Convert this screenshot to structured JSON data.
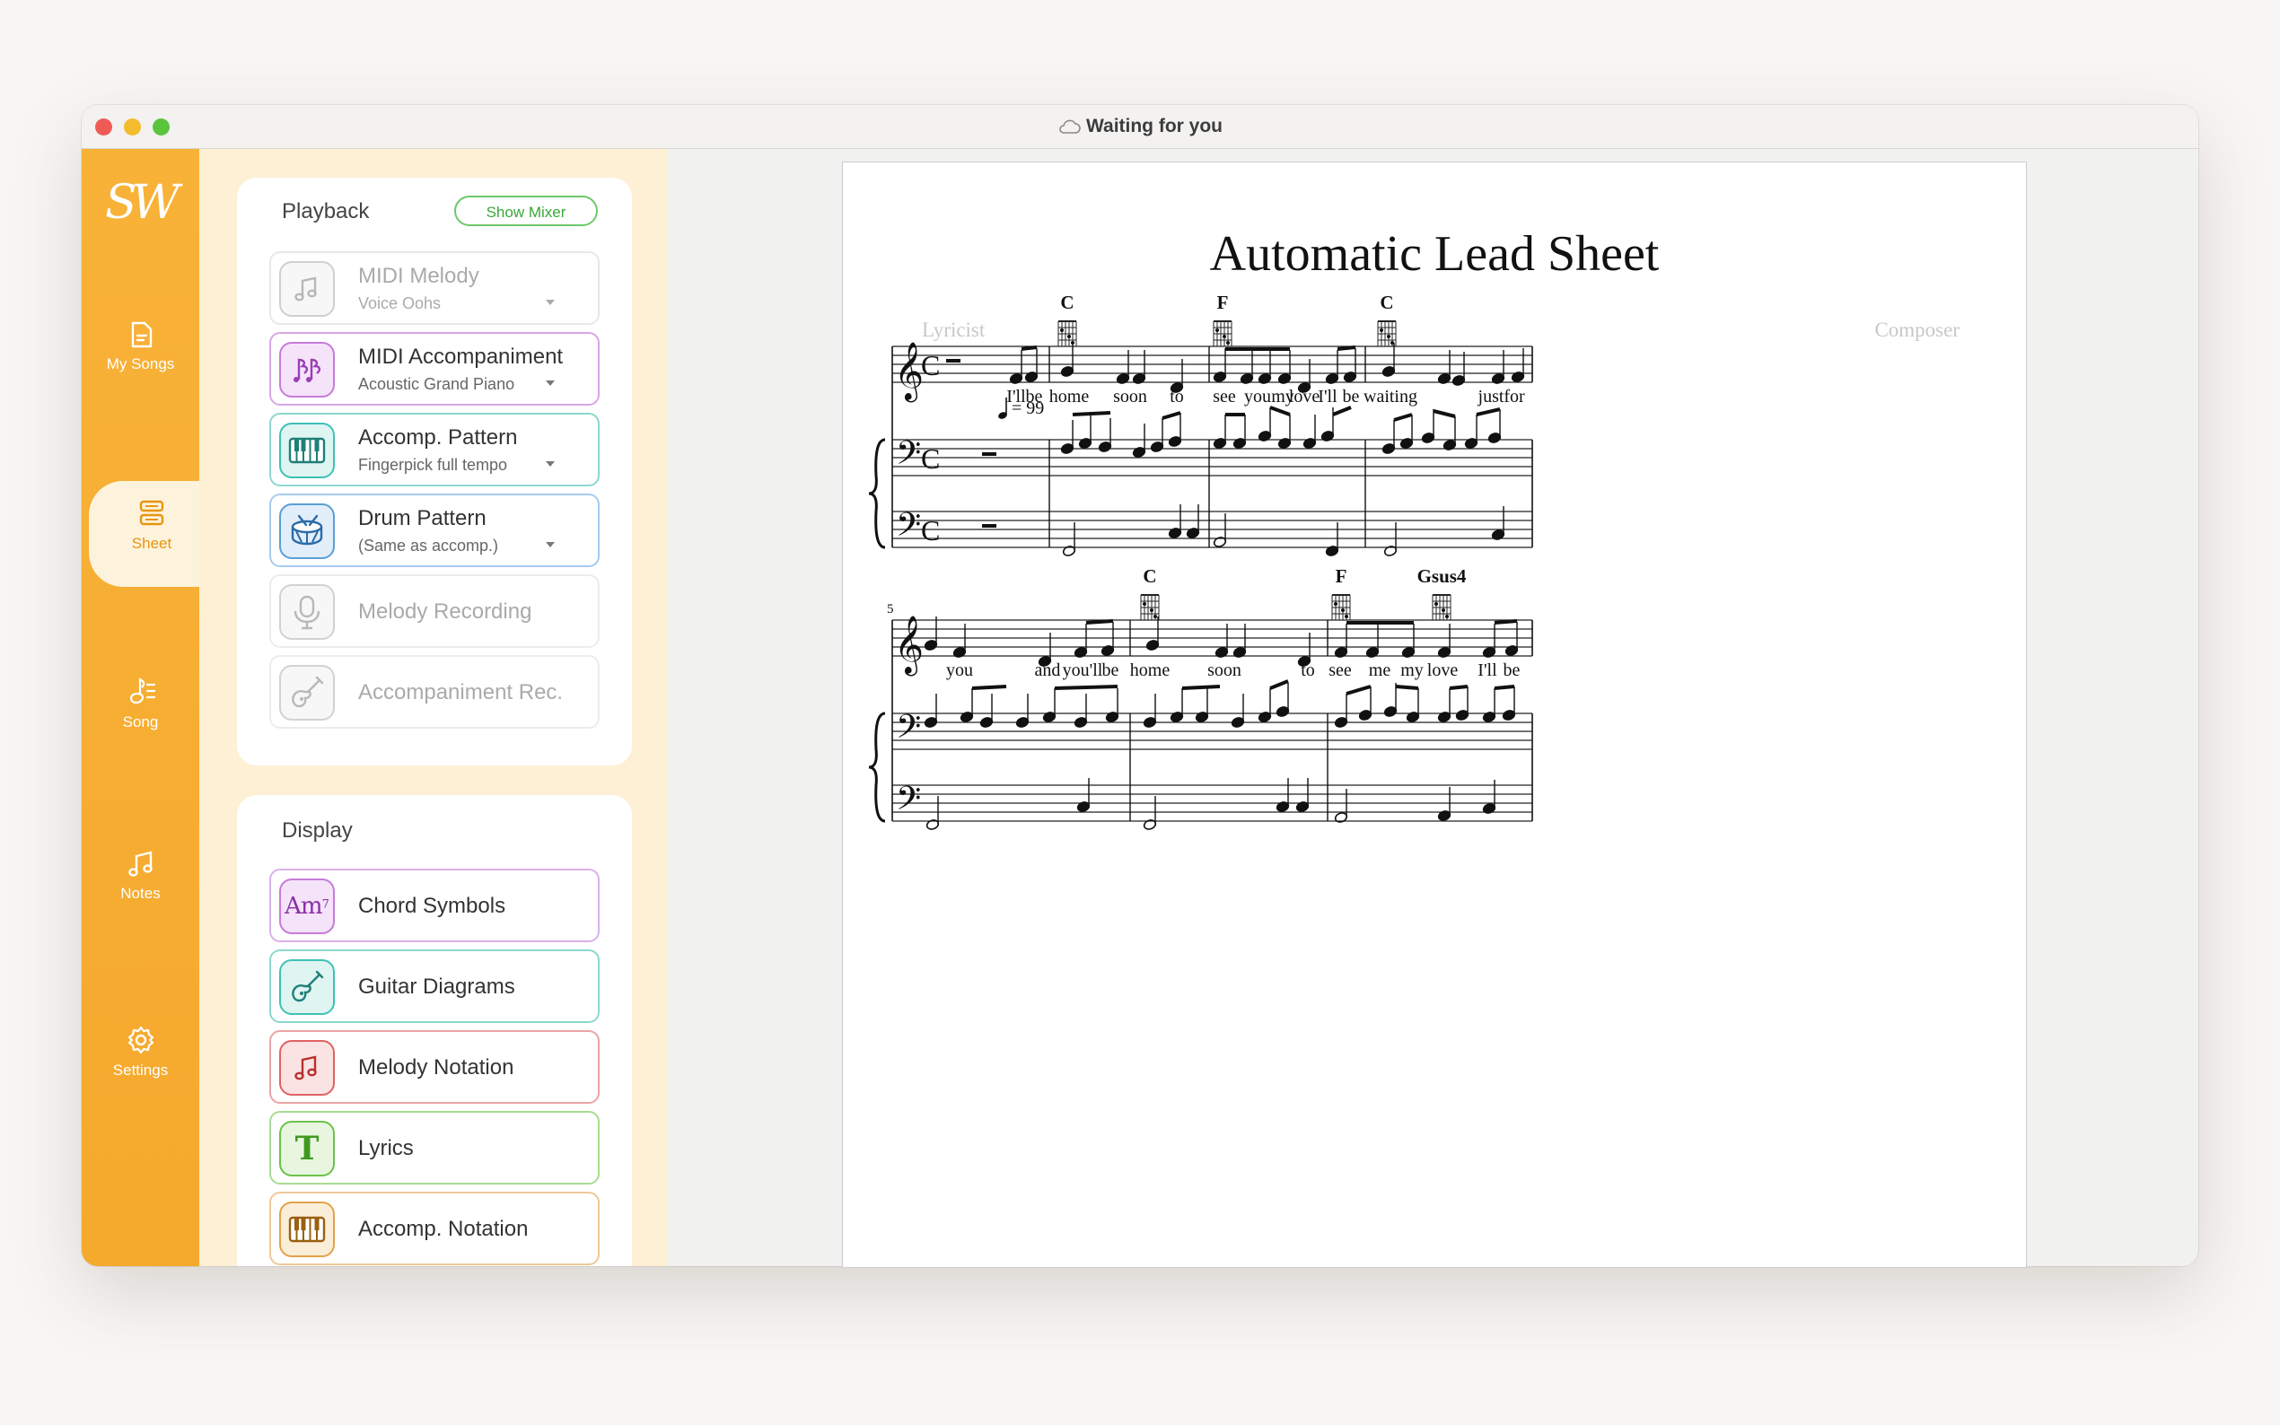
{
  "window": {
    "title": "Waiting for you"
  },
  "nav": {
    "logo": "SW",
    "items": [
      {
        "label": "My Songs",
        "icon": "document-icon"
      },
      {
        "label": "Sheet",
        "icon": "sheet-icon",
        "active": true
      },
      {
        "label": "Song",
        "icon": "song-icon"
      },
      {
        "label": "Notes",
        "icon": "notes-icon"
      },
      {
        "label": "Settings",
        "icon": "gear-icon"
      }
    ]
  },
  "playback": {
    "title": "Playback",
    "mixer_label": "Show Mixer",
    "rows": [
      {
        "label": "MIDI Melody",
        "sub": "Voice Oohs",
        "icon": "music-note-icon",
        "color": "#c8c8c8",
        "enabled": false
      },
      {
        "label": "MIDI Accompaniment",
        "sub": "Acoustic Grand Piano",
        "icon": "double-notes-icon",
        "color": "#c77bd9",
        "enabled": true
      },
      {
        "label": "Accomp. Pattern",
        "sub": "Fingerpick full tempo",
        "icon": "piano-icon",
        "color": "#3fc1b6",
        "enabled": true
      },
      {
        "label": "Drum Pattern",
        "sub": "(Same as accomp.)",
        "icon": "drum-icon",
        "color": "#5b9fd6",
        "enabled": true
      },
      {
        "label": "Melody Recording",
        "sub": "",
        "icon": "microphone-icon",
        "color": "#c8c8c8",
        "enabled": false
      },
      {
        "label": "Accompaniment Rec.",
        "sub": "",
        "icon": "guitar-icon",
        "color": "#c8c8c8",
        "enabled": false
      }
    ]
  },
  "display": {
    "title": "Display",
    "rows": [
      {
        "label": "Chord Symbols",
        "icon": "chord-symbol-icon",
        "icon_text": "Am",
        "icon_sup": "7",
        "color": "#c77bd9"
      },
      {
        "label": "Guitar Diagrams",
        "icon": "guitar-icon",
        "color": "#3fc1b6"
      },
      {
        "label": "Melody Notation",
        "icon": "music-note-icon",
        "color": "#e06262"
      },
      {
        "label": "Lyrics",
        "icon": "text-t-icon",
        "icon_text": "T",
        "color": "#6cc24a"
      },
      {
        "label": "Accomp. Notation",
        "icon": "piano-icon",
        "color": "#e3a24a"
      }
    ]
  },
  "sheet": {
    "title": "Automatic Lead Sheet",
    "lyricist": "Lyricist",
    "composer": "Composer",
    "tempo": "= 99",
    "system1": {
      "chords": [
        "C",
        "F",
        "C"
      ],
      "lyrics": [
        "I'll",
        "be",
        "home",
        "soon",
        "to",
        "see",
        "you",
        "my",
        "love",
        "I'll",
        "be",
        "waiting",
        "just",
        "for"
      ]
    },
    "system2": {
      "measure_number": "5",
      "chords": [
        "C",
        "F",
        "Gsus4"
      ],
      "lyrics": [
        "you",
        "and",
        "you'll",
        "be",
        "home",
        "soon",
        "to",
        "see",
        "me",
        "my",
        "love",
        "I'll",
        "be"
      ]
    }
  }
}
